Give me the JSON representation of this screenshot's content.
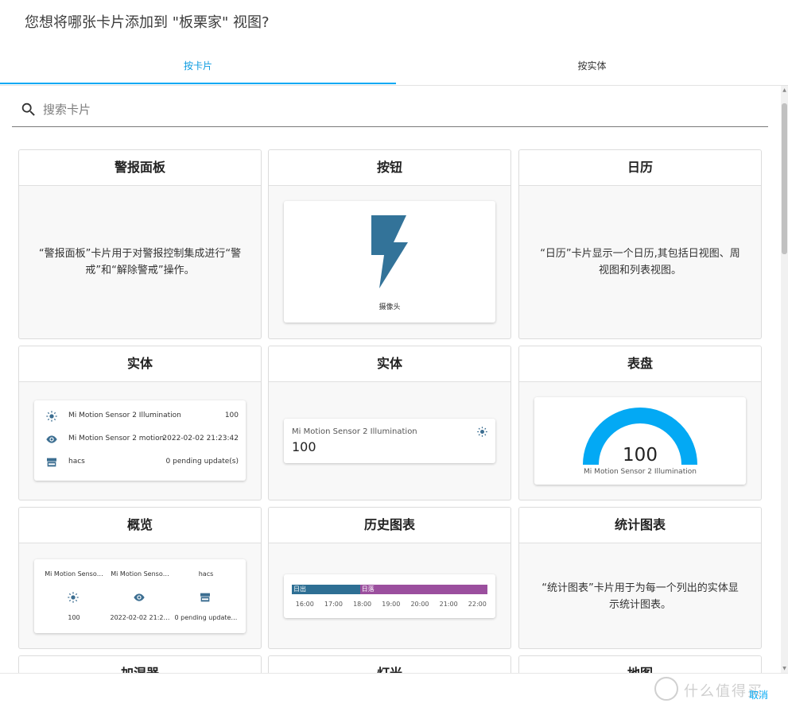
{
  "dialog": {
    "title": "您想将哪张卡片添加到 \"板栗家\" 视图?"
  },
  "tabs": [
    {
      "label": "按卡片"
    },
    {
      "label": "按实体"
    }
  ],
  "search": {
    "placeholder": "搜索卡片",
    "value": ""
  },
  "cards": {
    "alarm": {
      "title": "警报面板",
      "description": "“警报面板”卡片用于对警报控制集成进行“警戒”和“解除警戒”操作。"
    },
    "button": {
      "title": "按钮",
      "preview_label": "摄像头",
      "icon": "flash-icon",
      "icon_color": "#337399"
    },
    "calendar": {
      "title": "日历",
      "description": "“日历”卡片显示一个日历,其包括日视图、周视图和列表视图。"
    },
    "entities": {
      "title": "实体",
      "rows": [
        {
          "icon": "brightness-icon",
          "name": "Mi Motion Sensor 2 Illumination",
          "value": "100"
        },
        {
          "icon": "eye-icon",
          "name": "Mi Motion Sensor 2 motion",
          "value": "2022-02-02 21:23:42"
        },
        {
          "icon": "hacs-icon",
          "name": "hacs",
          "value": "0 pending update(s)"
        }
      ]
    },
    "entity": {
      "title": "实体",
      "name": "Mi Motion Sensor 2 Illumination",
      "value": "100",
      "icon": "brightness-icon"
    },
    "gauge": {
      "title": "表盘",
      "value": "100",
      "name": "Mi Motion Sensor 2 Illumination",
      "level": 1.0,
      "color": "#03a9f4"
    },
    "glance": {
      "title": "概览",
      "items": [
        {
          "name": "Mi Motion Senso…",
          "icon": "brightness-icon",
          "value": "100"
        },
        {
          "name": "Mi Motion Senso…",
          "icon": "eye-icon",
          "value": "2022-02-02 21:2…"
        },
        {
          "name": "hacs",
          "icon": "hacs-icon",
          "value": "0 pending update…"
        }
      ]
    },
    "history": {
      "title": "历史图表",
      "segments": [
        {
          "label": "日出",
          "color": "#2e6f94",
          "from": "15:33",
          "to": "17:55"
        },
        {
          "label": "日落",
          "color": "#9b4f9e",
          "from": "17:55",
          "to": "22:21"
        }
      ],
      "ticks": [
        "16:00",
        "17:00",
        "18:00",
        "19:00",
        "20:00",
        "21:00",
        "22:00"
      ]
    },
    "statistics": {
      "title": "统计图表",
      "description": "“统计图表”卡片用于为每一个列出的实体显示统计图表。"
    },
    "humidifier": {
      "title": "加湿器"
    },
    "light": {
      "title": "灯光"
    },
    "map": {
      "title": "地图"
    }
  },
  "footer": {
    "cancel_label": "取消",
    "watermark": "什么值得买"
  }
}
